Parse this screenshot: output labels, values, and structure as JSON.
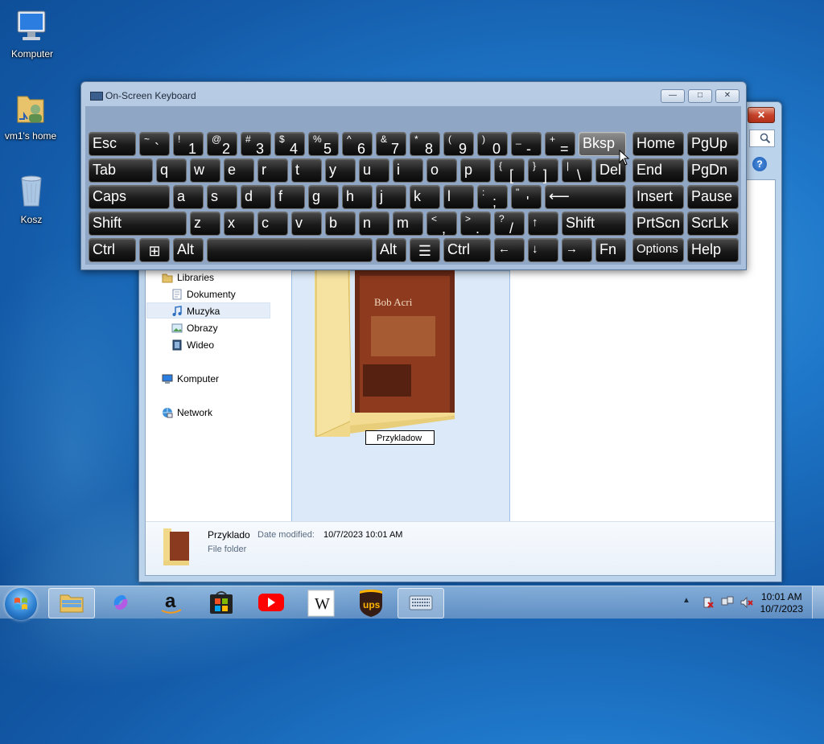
{
  "desktop": {
    "icons": [
      {
        "label": "Komputer"
      },
      {
        "label": "vm1's home"
      },
      {
        "label": "Kosz"
      }
    ]
  },
  "osk": {
    "title": "On-Screen Keyboard",
    "controls": {
      "minimize": "—",
      "restore": "□",
      "close": "✕"
    }
  },
  "explorer": {
    "close": "✕",
    "help": "?",
    "nav": {
      "libraries": "Libraries",
      "dokumenty": "Dokumenty",
      "muzyka": "Muzyka",
      "obrazy": "Obrazy",
      "wideo": "Wideo",
      "komputer": "Komputer",
      "network": "Network"
    },
    "folder": {
      "rename_value": "Przykladow",
      "album_title": "Bob Acri"
    },
    "details": {
      "name": "Przyklado",
      "modified_label": "Date modified:",
      "modified_value": "10/7/2023 10:01 AM",
      "type": "File folder"
    }
  },
  "taskbar": {
    "time": "10:01 AM",
    "date": "10/7/2023",
    "pinned": [
      "windows-explorer",
      "copilot",
      "amazon",
      "microsoft-store",
      "youtube",
      "wikipedia",
      "ups",
      "on-screen-keyboard"
    ],
    "wikipedia_glyph": "W",
    "ups_glyph": "ups",
    "amazon_glyph": "a"
  }
}
